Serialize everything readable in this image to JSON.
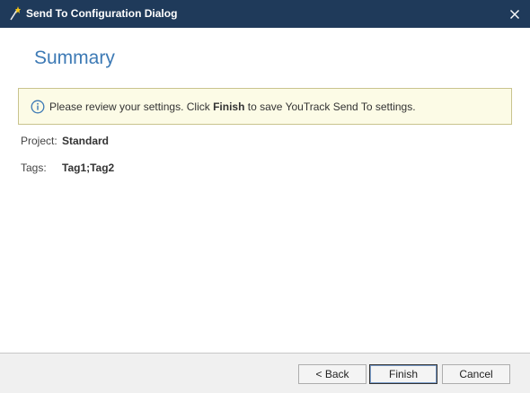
{
  "window": {
    "title": "Send To Configuration Dialog"
  },
  "page": {
    "heading": "Summary"
  },
  "info": {
    "text_before": "Please review your settings. Click ",
    "emphasis": "Finish",
    "text_after": " to save YouTrack Send To settings."
  },
  "fields": {
    "project_label": "Project:",
    "project_value": "Standard",
    "tags_label": "Tags:",
    "tags_value": "Tag1;Tag2"
  },
  "buttons": {
    "back": "< Back",
    "finish": "Finish",
    "cancel": "Cancel"
  },
  "colors": {
    "titlebar": "#1f3a5a",
    "heading": "#3d7ab5",
    "info_background": "#fcfbe6",
    "info_border": "#c9c48e",
    "info_icon": "#3d7ab5"
  },
  "icons": {
    "app": "magic-wand-icon",
    "close": "close-icon",
    "info": "info-circle-icon"
  }
}
